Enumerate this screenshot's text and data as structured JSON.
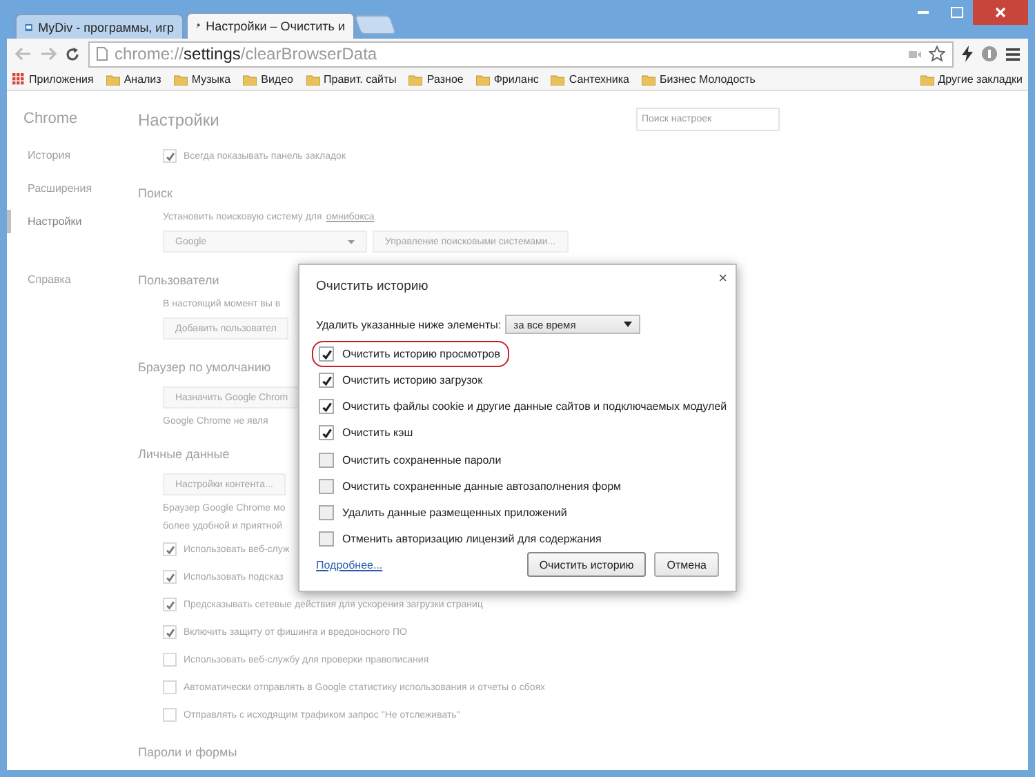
{
  "tabs": [
    {
      "label": "MyDiv - программы, игр",
      "selected": false
    },
    {
      "label": "Настройки – Очистить и",
      "selected": true
    }
  ],
  "address_bar": {
    "scheme": "chrome://",
    "host": "settings",
    "path": "/clearBrowserData"
  },
  "bookmarks": [
    {
      "label": "Приложения",
      "kind": "apps"
    },
    {
      "label": "Анализ",
      "kind": "folder"
    },
    {
      "label": "Музыка",
      "kind": "folder"
    },
    {
      "label": "Видео",
      "kind": "folder"
    },
    {
      "label": "Правит. сайты",
      "kind": "folder"
    },
    {
      "label": "Разное",
      "kind": "folder"
    },
    {
      "label": "Фриланс",
      "kind": "folder"
    },
    {
      "label": "Сантехника",
      "kind": "folder"
    },
    {
      "label": "Бизнес Молодость",
      "kind": "folder"
    }
  ],
  "other_bookmarks": "Другие закладки",
  "sidebar": {
    "title": "Chrome",
    "items": [
      {
        "label": "История",
        "selected": false
      },
      {
        "label": "Расширения",
        "selected": false
      },
      {
        "label": "Настройки",
        "selected": true
      },
      {
        "label": "Справка",
        "selected": false
      }
    ]
  },
  "settings": {
    "title": "Настройки",
    "search": {
      "placeholder": "Поиск настроек"
    },
    "blocks": [
      {
        "kind": "check",
        "label": "Всегда показывать панель закладок",
        "checked": true
      },
      {
        "kind": "heading",
        "label": "Поиск"
      },
      {
        "kind": "linktext",
        "label": "Установить поисковую систему для",
        "link": "омнибокса"
      },
      {
        "kind": "selectrow",
        "select": "Google",
        "button": "Управление поисковыми системами..."
      },
      {
        "kind": "heading",
        "label": "Пользователи"
      },
      {
        "kind": "text",
        "label": "В настоящий момент вы в"
      },
      {
        "kind": "button",
        "label": "Добавить пользовател"
      },
      {
        "kind": "heading",
        "label": "Браузер по умолчанию"
      },
      {
        "kind": "button",
        "label": "Назначить Google Chrom"
      },
      {
        "kind": "text",
        "label": "Google Chrome не явля"
      },
      {
        "kind": "heading",
        "label": "Личные данные"
      },
      {
        "kind": "button",
        "label": "Настройки контента..."
      },
      {
        "kind": "text",
        "label": "Браузер Google Chrome мо"
      },
      {
        "kind": "text",
        "label": "более удобной и приятной"
      },
      {
        "kind": "check",
        "label": "Использовать веб-служ",
        "checked": true
      },
      {
        "kind": "check",
        "label": "Использовать подсказ",
        "checked": true
      },
      {
        "kind": "check",
        "label": "Предсказывать сетевые действия для ускорения загрузки страниц",
        "checked": true
      },
      {
        "kind": "check",
        "label": "Включить защиту от фишинга и вредоносного ПО",
        "checked": true
      },
      {
        "kind": "check",
        "label": "Использовать веб-службу для проверки правописания",
        "checked": false
      },
      {
        "kind": "check",
        "label": "Автоматически отправлять в Google статистику использования и отчеты о сбоях",
        "checked": false
      },
      {
        "kind": "check",
        "label": "Отправлять с исходящим трафиком запрос \"Не отслеживать\"",
        "checked": false
      },
      {
        "kind": "heading",
        "label": "Пароли и формы"
      }
    ]
  },
  "dialog": {
    "title": "Очистить историю",
    "close": "×",
    "range_label": "Удалить указанные ниже элементы:",
    "range": "за все время",
    "items": [
      {
        "label": "Очистить историю просмотров",
        "checked": true,
        "highlighted": true
      },
      {
        "label": "Очистить историю загрузок",
        "checked": true,
        "highlighted": false
      },
      {
        "label": "Очистить файлы cookie и другие данные сайтов и подключаемых модулей",
        "checked": true,
        "highlighted": false
      },
      {
        "label": "Очистить кэш",
        "checked": true,
        "highlighted": false
      },
      {
        "label": "Очистить сохраненные пароли",
        "checked": false,
        "highlighted": false
      },
      {
        "label": "Очистить сохраненные данные автозаполнения форм",
        "checked": false,
        "highlighted": false
      },
      {
        "label": "Удалить данные размещенных приложений",
        "checked": false,
        "highlighted": false
      },
      {
        "label": "Отменить авторизацию лицензий для содержания",
        "checked": false,
        "highlighted": false
      }
    ],
    "link": "Подробнее...",
    "buttons": [
      {
        "label": "Очистить историю",
        "kind": "primary"
      },
      {
        "label": "Отмена",
        "kind": "cancel"
      }
    ]
  }
}
